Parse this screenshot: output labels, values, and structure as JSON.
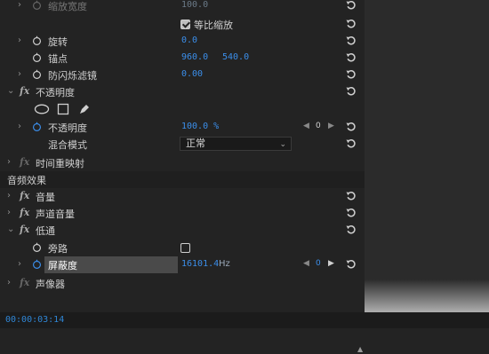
{
  "rows": {
    "scale_width": {
      "label": "缩放宽度",
      "value": "100.0"
    },
    "uniform_scale": {
      "label": "等比缩放"
    },
    "rotation": {
      "label": "旋转",
      "value": "0.0"
    },
    "anchor": {
      "label": "锚点",
      "x": "960.0",
      "y": "540.0"
    },
    "anti_flicker": {
      "label": "防闪烁滤镜",
      "value": "0.00"
    },
    "opacity_effect": {
      "label": "不透明度"
    },
    "opacity": {
      "label": "不透明度",
      "value": "100.0 %",
      "keyframe_index": "0"
    },
    "blend_mode": {
      "label": "混合模式",
      "value": "正常"
    },
    "time_remap": {
      "label": "时间重映射"
    },
    "audio_section": {
      "label": "音频效果"
    },
    "volume": {
      "label": "音量"
    },
    "channel_volume": {
      "label": "声道音量"
    },
    "lowpass": {
      "label": "低通"
    },
    "bypass": {
      "label": "旁路"
    },
    "cutoff": {
      "label": "屏蔽度",
      "value": "16101.4",
      "unit": "Hz",
      "keyframe_index": "0"
    },
    "panner": {
      "label": "声像器"
    }
  },
  "status": {
    "timecode": "00:00:03:14"
  },
  "icons": {
    "fx": "fx",
    "chevron": "chevron-right-icon",
    "stopwatch": "stopwatch-icon",
    "reset": "reset-icon"
  },
  "colors": {
    "accent": "#3b8eea",
    "background": "#232323",
    "timecode": "#2f86d6"
  }
}
